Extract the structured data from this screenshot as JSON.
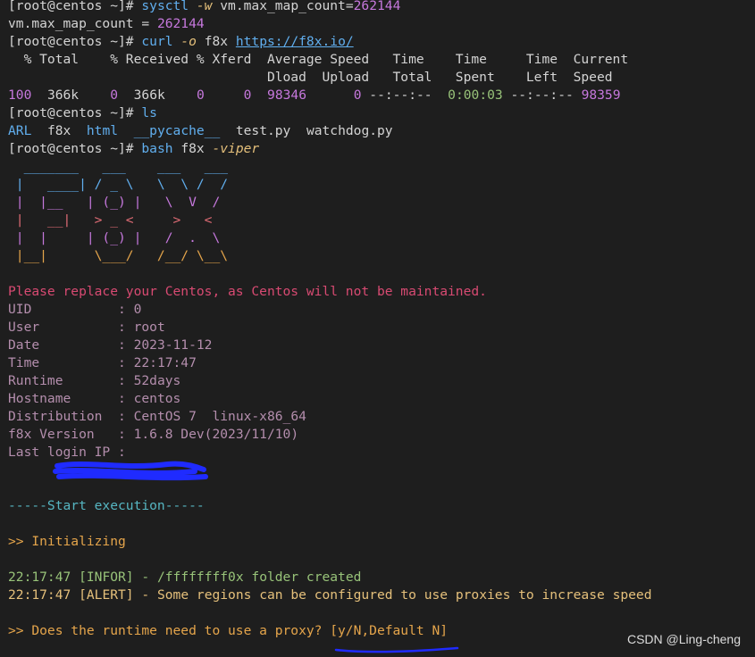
{
  "prompt": "[root@centos ~]# ",
  "lines": {
    "l1_cmd": "sysctl",
    "l1_flag": "-w",
    "l1_arg": "vm.max_map_count=",
    "l1_val": "262144",
    "l2": "vm.max_map_count = ",
    "l2_val": "262144",
    "l3_cmd": "curl",
    "l3_flag": "-o",
    "l3_arg": "f8x",
    "l3_url": "https://f8x.io/",
    "l4": "  % Total    % Received % Xferd  Average Speed   Time    Time     Time  Current",
    "l5": "                                 Dload  Upload   Total   Spent    Left  Speed",
    "l6a": "100",
    "l6b": "366k",
    "l6c": "0",
    "l6d": "366k",
    "l6e": "0",
    "l6f": "0",
    "l6g": "98346",
    "l6h": "0",
    "l6i": "--:--:--",
    "l6j": "0:00:03",
    "l6k": "--:--:--",
    "l6l": "98359",
    "l7_cmd": "ls",
    "l8": [
      "ARL",
      "f8x",
      "html",
      "__pycache__",
      "test.py",
      "watchdog.py"
    ],
    "l9_cmd": "bash",
    "l9_arg": "f8x",
    "l9_flag": "-viper"
  },
  "logo": [
    "  _______   ___    ___   ___",
    " |   ____| / _ \\   \\  \\ /  /",
    " |  |__   | (_) |   \\  V  /",
    " |   __|   > _ <     >   <",
    " |  |     | (_) |   /  .  \\",
    " |__|      \\___/   /__/ \\__\\"
  ],
  "warning": "Please replace your Centos, as Centos will not be maintained.",
  "info": [
    {
      "key": "UID           ",
      "sep": ": ",
      "val": "0"
    },
    {
      "key": "User          ",
      "sep": ": ",
      "val": "root"
    },
    {
      "key": "Date          ",
      "sep": ": ",
      "val": "2023-11-12"
    },
    {
      "key": "Time          ",
      "sep": ": ",
      "val": "22:17:47"
    },
    {
      "key": "Runtime       ",
      "sep": ": ",
      "val": "52days"
    },
    {
      "key": "Hostname      ",
      "sep": ": ",
      "val": "centos"
    },
    {
      "key": "Distribution  ",
      "sep": ": ",
      "val": "CentOS 7  linux-x86_64"
    },
    {
      "key": "f8x Version   ",
      "sep": ": ",
      "val": "1.6.8 Dev(2023/11/10)"
    },
    {
      "key": "Last login IP ",
      "sep": ": ",
      "val": ""
    }
  ],
  "start": "-----Start execution-----",
  "init": ">> Initializing",
  "log1_time": "22:17:47",
  "log1_tag": "[INFOR]",
  "log1_msg": "- /ffffffff0x folder created",
  "log2_time": "22:17:47",
  "log2_tag": "[ALERT]",
  "log2_msg": "- Some regions can be configured to use proxies to increase speed",
  "question": ">> Does the runtime need to use a proxy? ",
  "question_opts": "[y/N,Default N]",
  "watermark": "CSDN @Ling-cheng"
}
